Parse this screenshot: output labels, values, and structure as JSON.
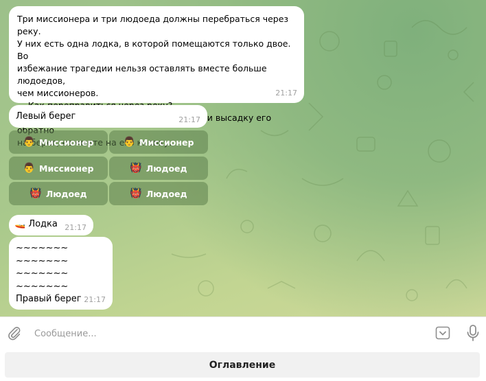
{
  "messages": {
    "intro": {
      "line1": "Три миссионера и три людоеда должны перебраться через реку.",
      "line2": "У них есть одна лодка, в которой помещаются только двое. Во",
      "line3": "избежание трагедии нельзя оставлять вместе больше людоедов,",
      "line4": "чем миссионеров.",
      "line5": "    Как переправиться через реку?",
      "line6": " Для перемещения персонажа в лодку или высадку его обратно",
      "line7": "на берег, нажмите на его кнопку.",
      "time": "21:17"
    },
    "left_bank": {
      "text": "Левый берег",
      "time": "21:17"
    },
    "boat": {
      "icon": "🚤",
      "text": "Лодка",
      "time": "21:17"
    },
    "right_bank": {
      "waves1": "~~~~~~~",
      "waves2": "~~~~~~~",
      "waves3": "~~~~~~~",
      "waves4": "~~~~~~~",
      "text": "Правый берег",
      "time": "21:17"
    }
  },
  "keyboard": {
    "buttons": [
      {
        "icon": "👨",
        "label": "Миссионер"
      },
      {
        "icon": "👨",
        "label": "Миссионер"
      },
      {
        "icon": "👨",
        "label": "Миссионер"
      },
      {
        "icon": "👹",
        "label": "Людоед"
      },
      {
        "icon": "👹",
        "label": "Людоед"
      },
      {
        "icon": "👹",
        "label": "Людоед"
      }
    ]
  },
  "composer": {
    "placeholder": "Сообщение..."
  },
  "menu_button": {
    "label": "Оглавление"
  }
}
